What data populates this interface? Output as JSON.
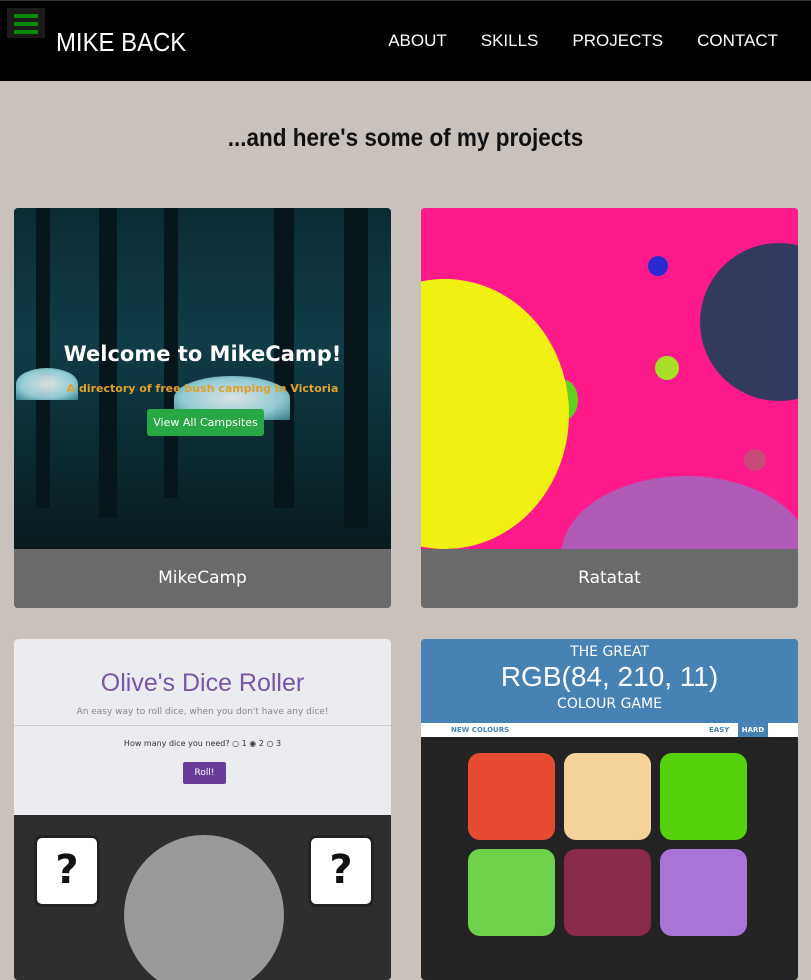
{
  "header": {
    "brand": "MIKE BACK",
    "nav": [
      "ABOUT",
      "SKILLS",
      "PROJECTS",
      "CONTACT"
    ]
  },
  "heading": "...and here's some of my projects",
  "projects": [
    {
      "label": "MikeCamp",
      "thumb": {
        "title": "Welcome to MikeCamp!",
        "subtitle": "A directory of free bush camping in Victoria",
        "button": "View All Campsites"
      }
    },
    {
      "label": "Ratatat"
    },
    {
      "label": "Olive's Dice Roller",
      "thumb": {
        "title": "Olive's Dice Roller",
        "subtitle": "An easy way to roll dice, when you don't have any dice!",
        "question": "How many dice you need?  ○ 1  ◉ 2  ○ 3",
        "button": "Roll!",
        "die_face": "?"
      }
    },
    {
      "label": "Colour Game",
      "thumb": {
        "line1": "THE GREAT",
        "rgb": "RGB(84, 210, 11)",
        "line3": "COLOUR GAME",
        "new_colours": "NEW COLOURS",
        "easy": "EASY",
        "hard": "HARD"
      }
    }
  ],
  "colors": {
    "background": "#c9c2bc",
    "header": "#000000",
    "hamburger": "#0a8a0a",
    "card_label": "#6a6a6a",
    "camp_button": "#28a745",
    "ratatat_bg": "#ff1a8c",
    "dice_accent": "#6a3c99",
    "colourgame_header": "#4682b4"
  },
  "icons": {
    "menu": "hamburger-icon"
  }
}
